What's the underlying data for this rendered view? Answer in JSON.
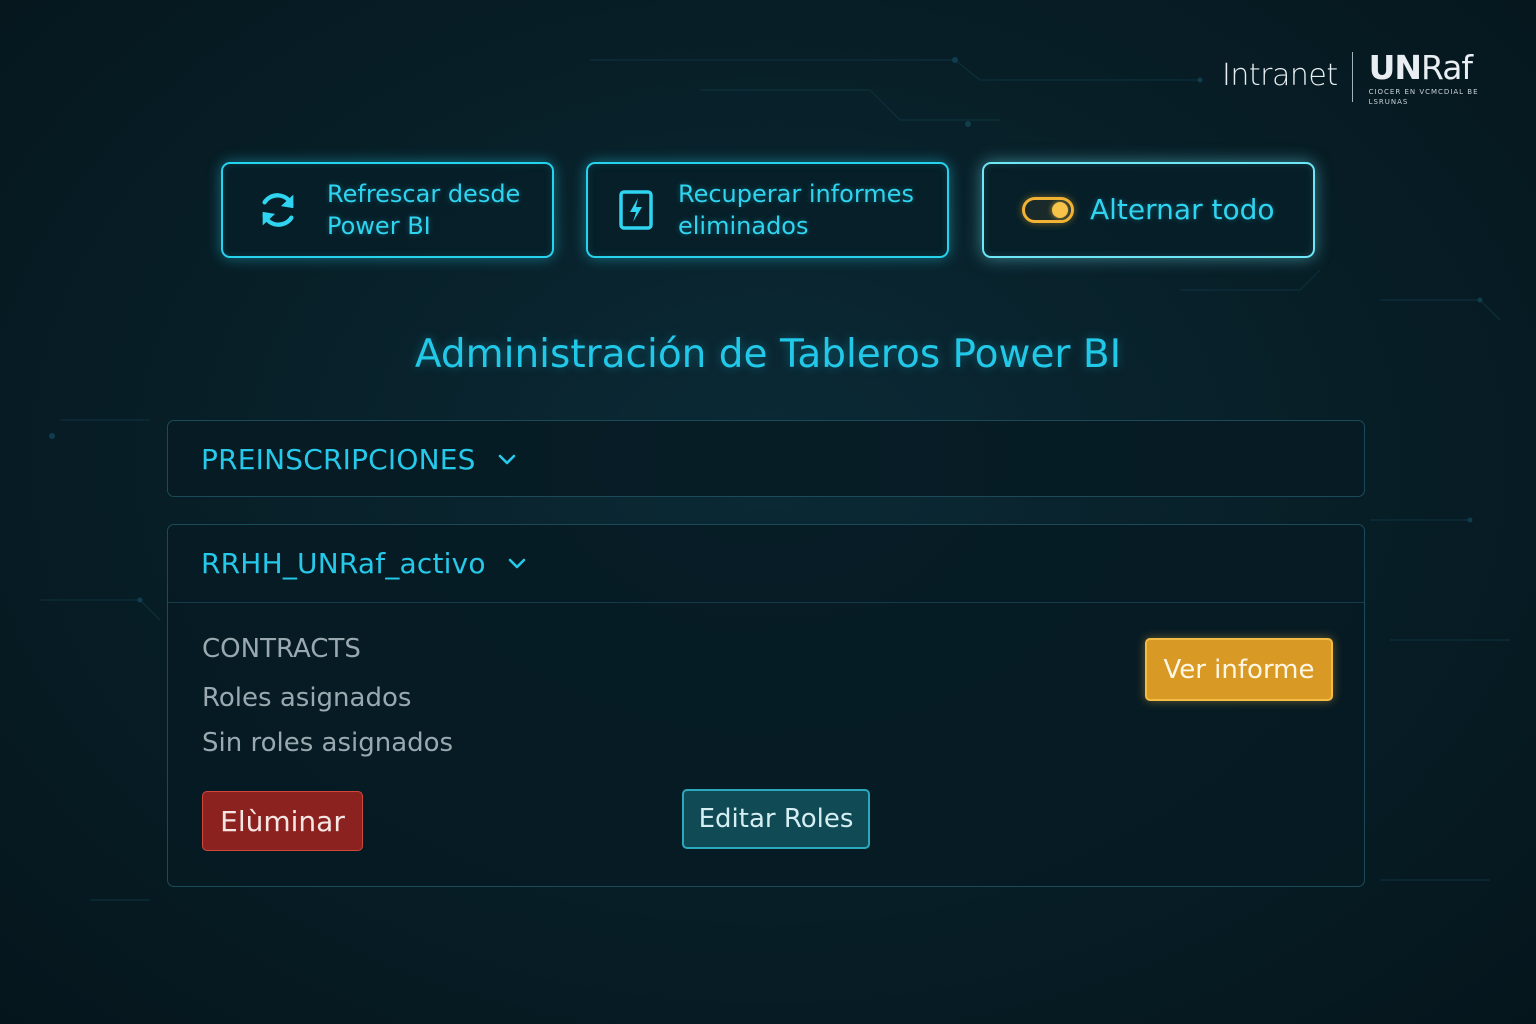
{
  "header": {
    "intranet_label": "Intranet",
    "logo_bold": "UN",
    "logo_regular": "Raf",
    "logo_tagline": "CIOCER EN VCMCDIAL BE LSRUNAS"
  },
  "toolbar": {
    "refresh_label": "Refrescar desde\nPower BI",
    "recover_label": "Recuperar informes\neliminados",
    "toggle_label": "Alternar todo",
    "toggle_state": "on"
  },
  "main": {
    "title": "Administración de Tableros Power BI",
    "panels": [
      {
        "title": "PREINSCRIPCIONES",
        "expanded": false
      },
      {
        "title": "RRHH_UNRaf_activo",
        "expanded": true,
        "report_name": "CONTRACTS",
        "roles_label": "Roles asignados",
        "roles_value": "Sin roles asignados",
        "view_button": "Ver informe",
        "delete_button": "Elùminar",
        "edit_roles_button": "Editar Roles"
      }
    ]
  },
  "colors": {
    "background": "#071c25",
    "accent_cyan": "#25d3ee",
    "warning_amber": "#d99a25",
    "danger_red": "#8c2220",
    "teal_button": "#0f4a55"
  },
  "icons": {
    "refresh": "refresh-icon",
    "recover": "bolt-document-icon",
    "toggle": "toggle-switch-icon",
    "chevron": "chevron-down-icon"
  }
}
